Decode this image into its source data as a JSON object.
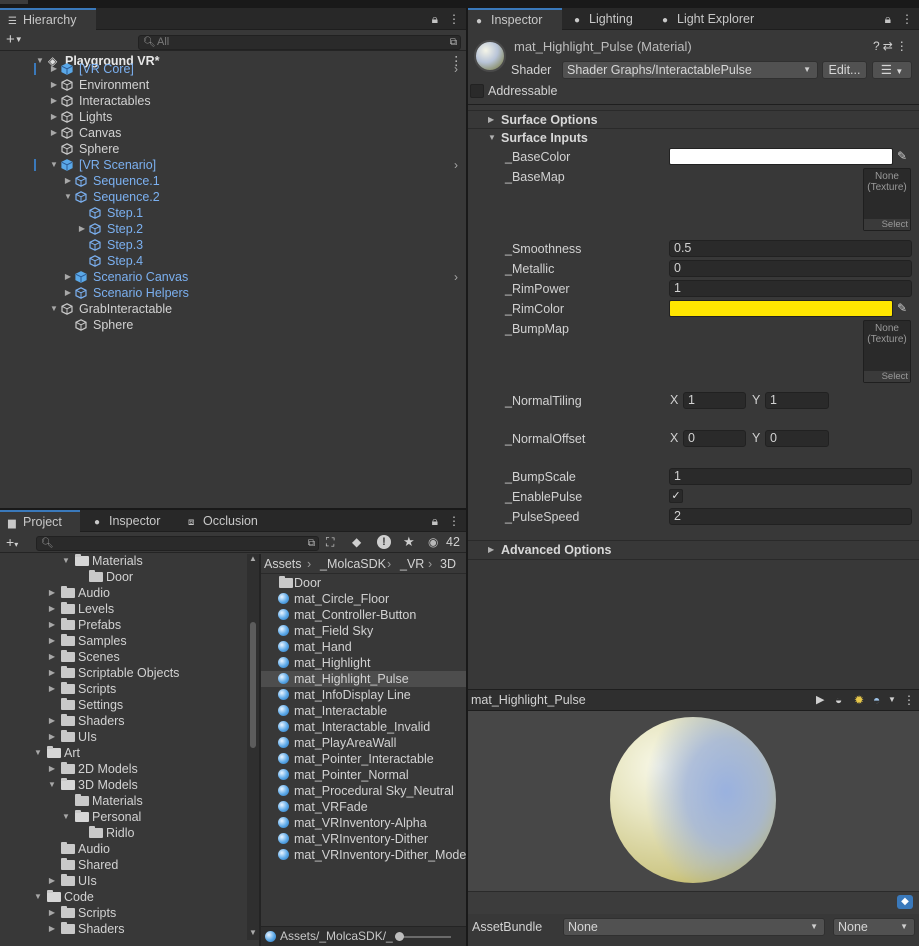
{
  "hierarchy": {
    "tab_label": "Hierarchy",
    "search_placeholder": "All",
    "scene_name": "Playground VR*",
    "items": [
      {
        "label": "[VR Core]"
      },
      {
        "label": "Environment"
      },
      {
        "label": "Interactables"
      },
      {
        "label": "Lights"
      },
      {
        "label": "Canvas"
      },
      {
        "label": "Sphere"
      },
      {
        "label": "[VR Scenario]"
      },
      {
        "label": "Sequence.1"
      },
      {
        "label": "Sequence.2"
      },
      {
        "label": "Step.1"
      },
      {
        "label": "Step.2"
      },
      {
        "label": "Step.3"
      },
      {
        "label": "Step.4"
      },
      {
        "label": "Scenario Canvas"
      },
      {
        "label": "Scenario Helpers"
      },
      {
        "label": "GrabInteractable"
      },
      {
        "label": "Sphere"
      }
    ]
  },
  "project": {
    "tabs": [
      {
        "label": "Project"
      },
      {
        "label": "Inspector"
      },
      {
        "label": "Occlusion"
      }
    ],
    "visible_count": "42",
    "breadcrumb": [
      "Assets",
      "_MolcaSDK",
      "_VR",
      "3D"
    ],
    "folders": [
      {
        "label": "Materials"
      },
      {
        "label": "Door"
      },
      {
        "label": "Audio"
      },
      {
        "label": "Levels"
      },
      {
        "label": "Prefabs"
      },
      {
        "label": "Samples"
      },
      {
        "label": "Scenes"
      },
      {
        "label": "Scriptable Objects"
      },
      {
        "label": "Scripts"
      },
      {
        "label": "Settings"
      },
      {
        "label": "Shaders"
      },
      {
        "label": "UIs"
      },
      {
        "label": "Art"
      },
      {
        "label": "2D Models"
      },
      {
        "label": "3D Models"
      },
      {
        "label": "Materials"
      },
      {
        "label": "Personal"
      },
      {
        "label": "Ridlo"
      },
      {
        "label": "Audio"
      },
      {
        "label": "Shared"
      },
      {
        "label": "UIs"
      },
      {
        "label": "Code"
      },
      {
        "label": "Scripts"
      },
      {
        "label": "Shaders"
      }
    ],
    "assets": [
      {
        "label": "Door"
      },
      {
        "label": "mat_Circle_Floor"
      },
      {
        "label": "mat_Controller-Button"
      },
      {
        "label": "mat_Field Sky"
      },
      {
        "label": "mat_Hand"
      },
      {
        "label": "mat_Highlight"
      },
      {
        "label": "mat_Highlight_Pulse"
      },
      {
        "label": "mat_InfoDisplay Line"
      },
      {
        "label": "mat_Interactable"
      },
      {
        "label": "mat_Interactable_Invalid"
      },
      {
        "label": "mat_PlayAreaWall"
      },
      {
        "label": "mat_Pointer_Interactable"
      },
      {
        "label": "mat_Pointer_Normal"
      },
      {
        "label": "mat_Procedural Sky_Neutral"
      },
      {
        "label": "mat_VRFade"
      },
      {
        "label": "mat_VRInventory-Alpha"
      },
      {
        "label": "mat_VRInventory-Dither"
      },
      {
        "label": "mat_VRInventory-Dither_Mode"
      }
    ],
    "footer_path": "Assets/_MolcaSDK/_"
  },
  "inspector": {
    "tabs": [
      {
        "label": "Inspector"
      },
      {
        "label": "Lighting"
      },
      {
        "label": "Light Explorer"
      }
    ],
    "material_title": "mat_Highlight_Pulse (Material)",
    "shader_label": "Shader",
    "shader_value": "Shader Graphs/InteractablePulse",
    "edit_label": "Edit...",
    "addressable_label": "Addressable",
    "surface_options": "Surface Options",
    "surface_inputs": "Surface Inputs",
    "advanced_options": "Advanced Options",
    "props": {
      "base_color": "_BaseColor",
      "base_map": "_BaseMap",
      "smoothness": "_Smoothness",
      "smoothness_value": "0.5",
      "metallic": "_Metallic",
      "metallic_value": "0",
      "rim_power": "_RimPower",
      "rim_power_value": "1",
      "rim_color": "_RimColor",
      "bump_map": "_BumpMap",
      "normal_tiling": "_NormalTiling",
      "normal_tiling_x": "1",
      "normal_tiling_y": "1",
      "normal_offset": "_NormalOffset",
      "normal_offset_x": "0",
      "normal_offset_y": "0",
      "bump_scale": "_BumpScale",
      "bump_scale_value": "1",
      "enable_pulse": "_EnablePulse",
      "pulse_speed": "_PulseSpeed",
      "pulse_speed_value": "2"
    },
    "tex_none": "None",
    "tex_type": "(Texture)",
    "tex_select": "Select",
    "x_label": "X",
    "y_label": "Y",
    "preview_title": "mat_Highlight_Pulse",
    "assetbundle_label": "AssetBundle",
    "assetbundle_value": "None",
    "assetbundle_variant": "None",
    "colors": {
      "base_color": "#ffffff",
      "rim_color": "#ffe600",
      "accent": "#3a79bb",
      "selection_text": "#7bb0f0"
    }
  }
}
